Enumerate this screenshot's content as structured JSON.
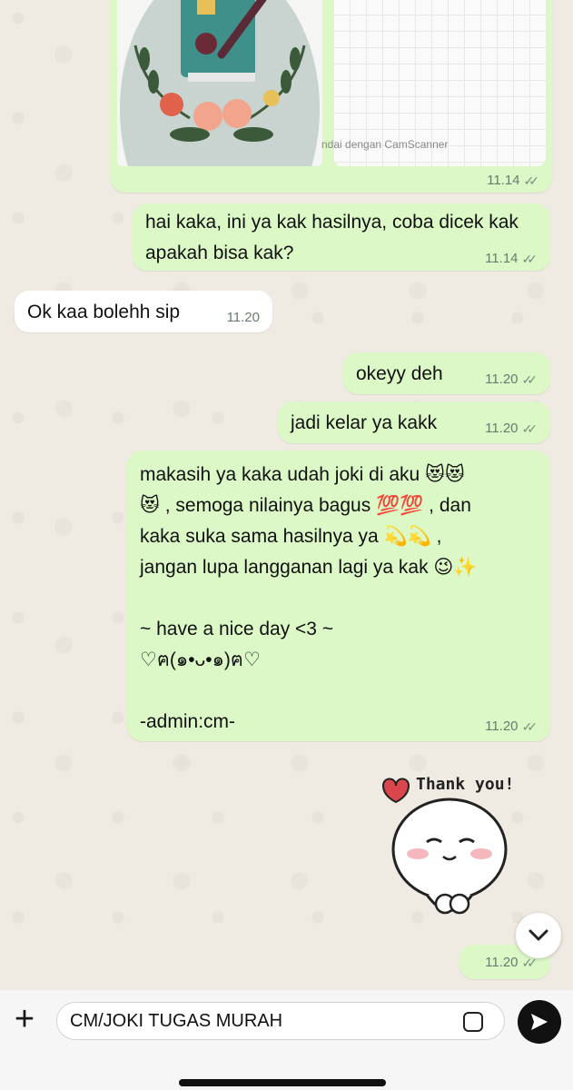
{
  "messages": [
    {
      "id": "m0",
      "time": "11.14",
      "caption": "ndai dengan CamScanner"
    },
    {
      "id": "m1",
      "text": "hai kaka, ini ya kak hasilnya, coba dicek kak apakah bisa kak?",
      "time": "11.14"
    },
    {
      "id": "m2",
      "text": "Ok kaa bolehh sip",
      "time": "11.20"
    },
    {
      "id": "m3",
      "text": "okeyy deh",
      "time": "11.20"
    },
    {
      "id": "m4",
      "text": "jadi kelar ya kakk",
      "time": "11.20"
    },
    {
      "id": "m5",
      "lines": [
        "makasih ya kaka udah joki di aku 😻😻",
        "😻 , semoga nilainya bagus 💯💯 , dan",
        "kaka suka sama hasilnya ya 💫💫 ,",
        "jangan lupa langganan lagi ya kak 😉✨",
        "",
        "~ have a nice day <3 ~",
        "♡ฅ(๑•ᴗ•๑)ฅ♡",
        "",
        "-admin:cm-"
      ],
      "time": "11.20"
    },
    {
      "id": "m6",
      "sticker_text": "Thank you!",
      "time": "11.20"
    }
  ],
  "composer": {
    "value": "CM/JOKI TUGAS MURAH",
    "attach_icon": "plus-icon",
    "sticker_icon": "sticker-icon",
    "send_icon": "send-icon"
  },
  "colors": {
    "outgoing": "#dbf8c6",
    "incoming": "#ffffff",
    "background": "#efeae2"
  }
}
